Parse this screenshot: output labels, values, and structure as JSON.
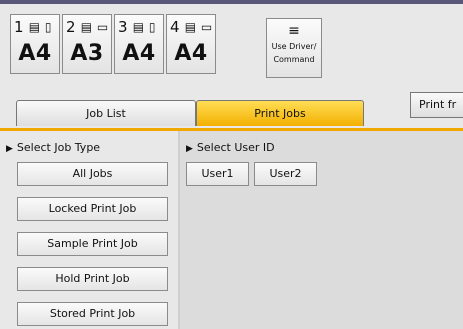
{
  "trays": [
    {
      "number": "1",
      "size": "A4",
      "paper_icon": "paper-stack-icon",
      "orientation_icon": "portrait-sheet-icon"
    },
    {
      "number": "2",
      "size": "A3",
      "paper_icon": "paper-stack-icon",
      "orientation_icon": "landscape-sheet-icon"
    },
    {
      "number": "3",
      "size": "A4",
      "paper_icon": "paper-stack-icon",
      "orientation_icon": "portrait-sheet-icon"
    },
    {
      "number": "4",
      "size": "A4",
      "paper_icon": "paper-stack-icon",
      "orientation_icon": "landscape-sheet-icon"
    }
  ],
  "driver_button": {
    "icon": "driver-command-icon",
    "line1": "Use Driver/",
    "line2": "Command"
  },
  "tabs": {
    "job_list": "Job List",
    "print_jobs": "Print Jobs",
    "print_from": "Print fr"
  },
  "job_type": {
    "title": "Select Job Type",
    "buttons": [
      "All Jobs",
      "Locked Print Job",
      "Sample Print Job",
      "Hold Print Job",
      "Stored Print Job"
    ]
  },
  "user_id": {
    "title": "Select User ID",
    "buttons": [
      "User1",
      "User2"
    ]
  },
  "colors": {
    "active_tab": "#f6c11e",
    "accent_line": "#f0a800",
    "panel_bg": "#e8e8e8"
  }
}
